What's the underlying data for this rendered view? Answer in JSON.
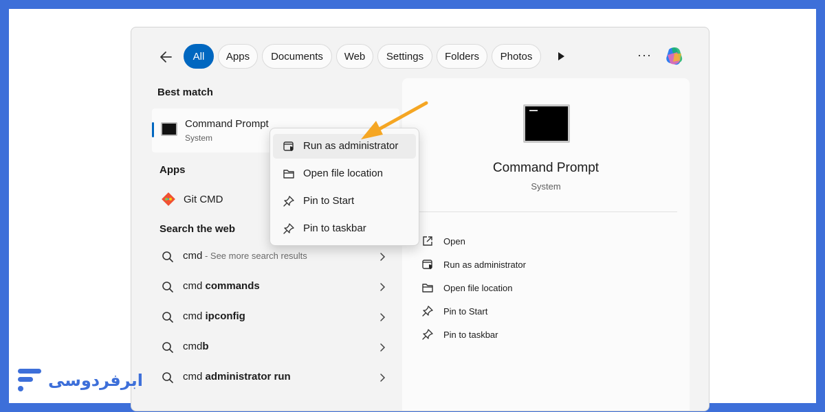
{
  "filters": {
    "back_icon": "arrow-left-icon",
    "tabs": [
      {
        "label": "All",
        "active": true
      },
      {
        "label": "Apps",
        "active": false
      },
      {
        "label": "Documents",
        "active": false
      },
      {
        "label": "Web",
        "active": false
      },
      {
        "label": "Settings",
        "active": false
      },
      {
        "label": "Folders",
        "active": false
      },
      {
        "label": "Photos",
        "active": false
      }
    ],
    "more_icon": "play-triangle-icon",
    "overflow": "···",
    "copilot_icon": "copilot-icon"
  },
  "best_match": {
    "heading": "Best match",
    "title": "Command Prompt",
    "subtitle": "System"
  },
  "apps": {
    "heading": "Apps",
    "items": [
      {
        "label": "Git CMD",
        "icon": "git-icon"
      }
    ]
  },
  "web": {
    "heading": "Search the web",
    "items": [
      {
        "prefix": "cmd",
        "bold": "",
        "hint": " - See more search results"
      },
      {
        "prefix": "cmd ",
        "bold": "commands",
        "hint": ""
      },
      {
        "prefix": "cmd ",
        "bold": "ipconfig",
        "hint": ""
      },
      {
        "prefix": "cmd",
        "bold": "b",
        "hint": ""
      },
      {
        "prefix": "cmd ",
        "bold": "administrator run",
        "hint": ""
      }
    ]
  },
  "context_menu": {
    "items": [
      {
        "label": "Run as administrator",
        "icon": "shield-window-icon"
      },
      {
        "label": "Open file location",
        "icon": "folder-icon"
      },
      {
        "label": "Pin to Start",
        "icon": "pin-icon"
      },
      {
        "label": "Pin to taskbar",
        "icon": "pin-icon"
      }
    ]
  },
  "detail": {
    "title": "Command Prompt",
    "subtitle": "System",
    "actions": [
      {
        "label": "Open",
        "icon": "open-external-icon"
      },
      {
        "label": "Run as administrator",
        "icon": "shield-window-icon"
      },
      {
        "label": "Open file location",
        "icon": "folder-icon"
      },
      {
        "label": "Pin to Start",
        "icon": "pin-icon"
      },
      {
        "label": "Pin to taskbar",
        "icon": "pin-icon"
      }
    ]
  },
  "colors": {
    "frame": "#3d6fd9",
    "accent": "#0067c0",
    "arrow": "#f5a623"
  },
  "branding": {
    "logo_text": "ابرفردوسی"
  }
}
